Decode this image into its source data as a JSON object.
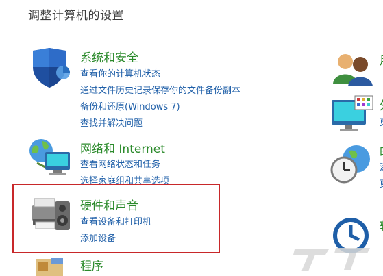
{
  "page": {
    "title": "调整计算机的设置"
  },
  "categories": [
    {
      "title": "系统和安全",
      "icon": "shield-icon",
      "links": [
        "查看你的计算机状态",
        "通过文件历史记录保存你的文件备份副本",
        "备份和还原(Windows 7)",
        "查找并解决问题"
      ]
    },
    {
      "title": "网络和 Internet",
      "icon": "network-globe-icon",
      "links": [
        "查看网络状态和任务",
        "选择家庭组和共享选项"
      ]
    },
    {
      "title": "硬件和声音",
      "icon": "printer-speaker-icon",
      "links": [
        "查看设备和打印机",
        "添加设备"
      ]
    },
    {
      "title": "程序",
      "icon": "programs-icon",
      "links": []
    }
  ],
  "right_column": {
    "icons": [
      "user-accounts-icon",
      "appearance-icon",
      "clock-region-icon",
      "ease-of-access-icon"
    ],
    "fragments": [
      "用",
      "外",
      "更",
      "时",
      "添",
      "更",
      "轻"
    ]
  },
  "colors": {
    "title_green": "#2b8a2b",
    "link_blue": "#1f5fa8",
    "highlight_red": "#c8282a"
  }
}
